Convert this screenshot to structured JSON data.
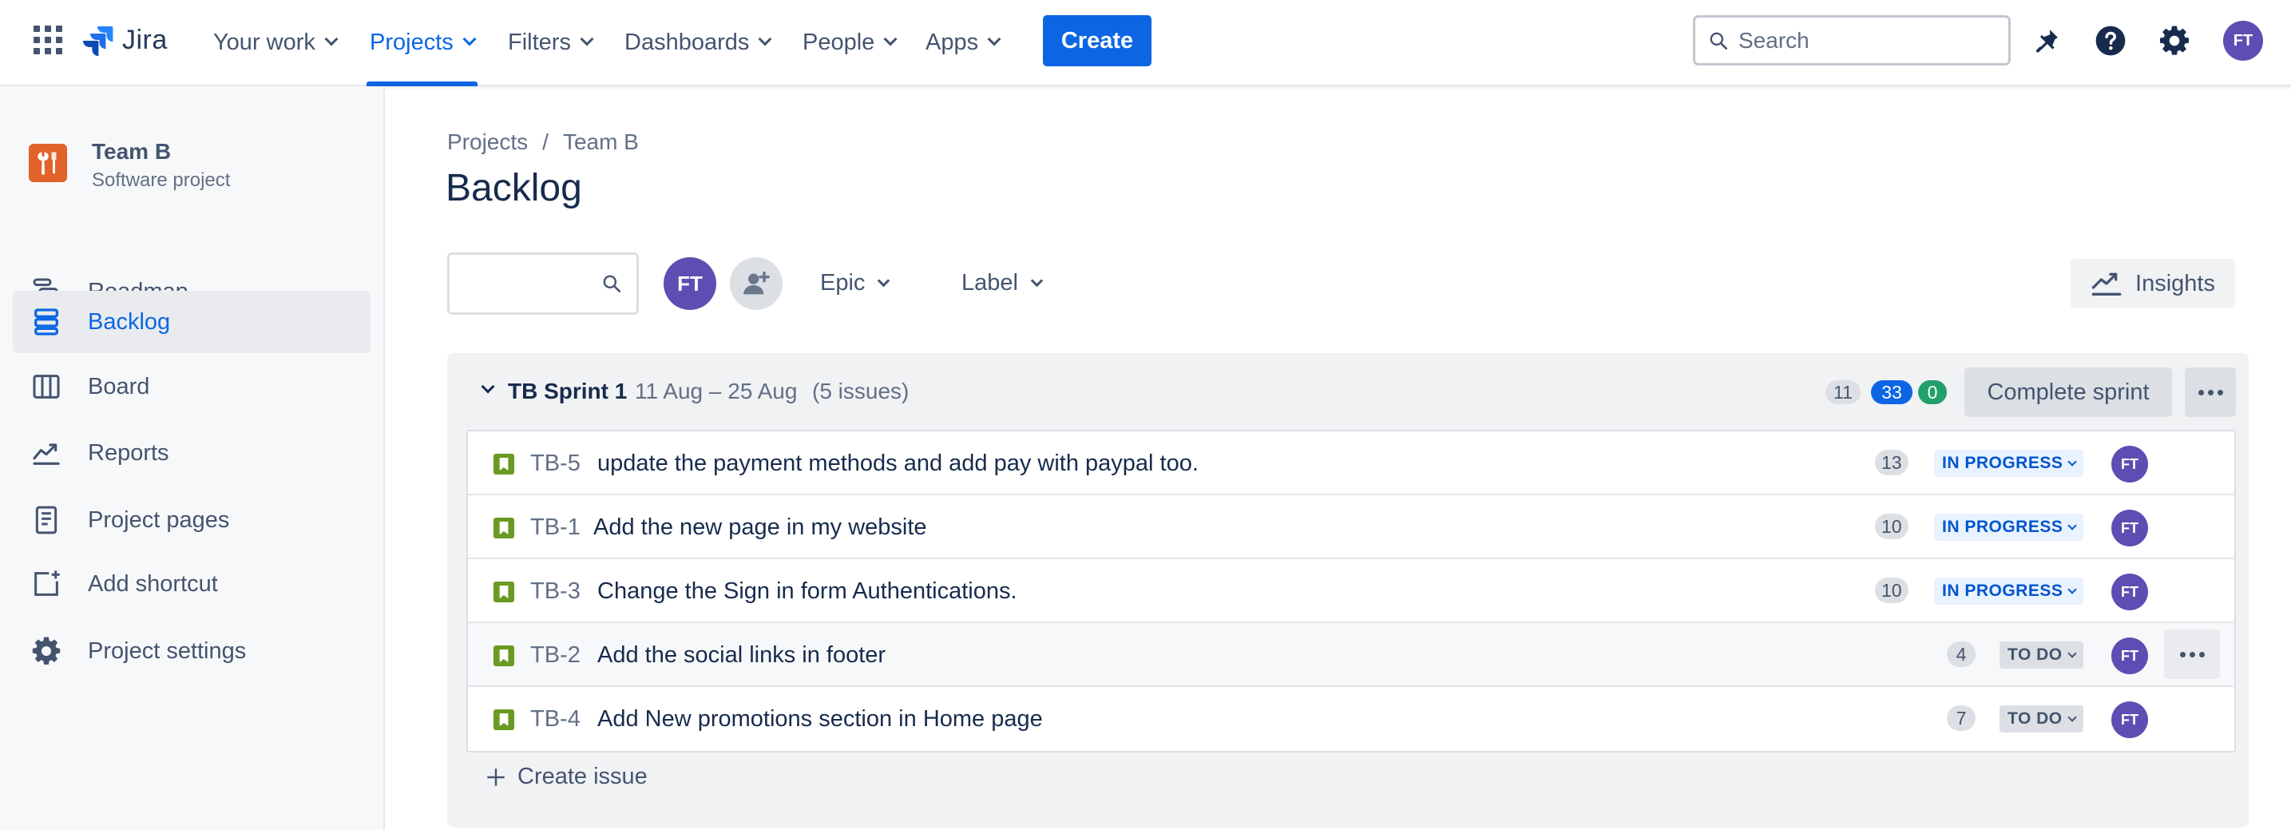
{
  "app": {
    "logo_text": "Jira"
  },
  "nav": {
    "items": [
      {
        "label": "Your work",
        "active": false
      },
      {
        "label": "Projects",
        "active": true
      },
      {
        "label": "Filters",
        "active": false
      },
      {
        "label": "Dashboards",
        "active": false
      },
      {
        "label": "People",
        "active": false
      },
      {
        "label": "Apps",
        "active": false
      }
    ],
    "create_label": "Create",
    "search_placeholder": "Search",
    "user_initials": "FT"
  },
  "sidebar": {
    "project_name": "Team B",
    "project_type": "Software project",
    "items": [
      {
        "label": "Roadmap",
        "icon": "roadmap-icon",
        "active": false
      },
      {
        "label": "Backlog",
        "icon": "backlog-icon",
        "active": true
      },
      {
        "label": "Board",
        "icon": "board-icon",
        "active": false
      },
      {
        "label": "Reports",
        "icon": "reports-icon",
        "active": false
      },
      {
        "label": "Project pages",
        "icon": "page-icon",
        "active": false
      },
      {
        "label": "Add shortcut",
        "icon": "add-shortcut-icon",
        "active": false
      },
      {
        "label": "Project settings",
        "icon": "gear-icon",
        "active": false
      }
    ]
  },
  "breadcrumb": {
    "items": [
      "Projects",
      "Team B"
    ],
    "separator": "/"
  },
  "page": {
    "title": "Backlog"
  },
  "filters": {
    "avatar_initials": "FT",
    "epic_label": "Epic",
    "label_label": "Label",
    "insights_label": "Insights"
  },
  "sprint": {
    "name": "TB Sprint 1",
    "dates": "11 Aug – 25 Aug",
    "issue_count": "(5 issues)",
    "counts": {
      "todo": "11",
      "in_progress": "33",
      "done": "0"
    },
    "complete_label": "Complete sprint",
    "issues": [
      {
        "key": "TB-5",
        "summary": "update the payment methods and add pay with paypal too.",
        "estimate": "13",
        "status": "IN PROGRESS",
        "assignee": "FT"
      },
      {
        "key": "TB-1",
        "summary": "Add the new page in my website",
        "estimate": "10",
        "status": "IN PROGRESS",
        "assignee": "FT"
      },
      {
        "key": "TB-3",
        "summary": "Change the Sign in form Authentications.",
        "estimate": "10",
        "status": "IN PROGRESS",
        "assignee": "FT"
      },
      {
        "key": "TB-2",
        "summary": "Add the social links in footer",
        "estimate": "4",
        "status": "TO DO",
        "assignee": "FT"
      },
      {
        "key": "TB-4",
        "summary": "Add New promotions section in Home page",
        "estimate": "7",
        "status": "TO DO",
        "assignee": "FT"
      }
    ],
    "create_issue_label": "Create issue"
  },
  "colors": {
    "brand_blue": "#0c66e4",
    "avatar_purple": "#5e4db2",
    "story_green": "#6a9a23",
    "project_orange": "#e2622b"
  }
}
